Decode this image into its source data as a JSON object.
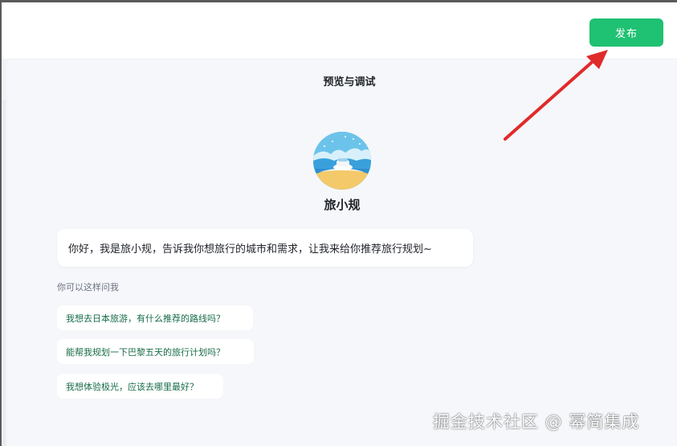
{
  "header": {
    "publish_label": "发布"
  },
  "preview": {
    "title": "预览与调试",
    "bot_name": "旅小规",
    "greeting": "你好，我是旅小规，告诉我你想旅行的城市和需求，让我来给你推荐旅行规划~",
    "hint": "你可以这样问我",
    "suggestions": [
      "我想去日本旅游，有什么推荐的路线吗？",
      "能帮我规划一下巴黎五天的旅行计划吗？",
      "我想体验极光，应该去哪里最好？"
    ]
  },
  "watermark": "掘金技术社区 @ 幂简集成",
  "annotation": {
    "arrow_color": "#e02a2a"
  },
  "colors": {
    "accent": "#1fc173",
    "suggestion_text": "#166c47"
  }
}
